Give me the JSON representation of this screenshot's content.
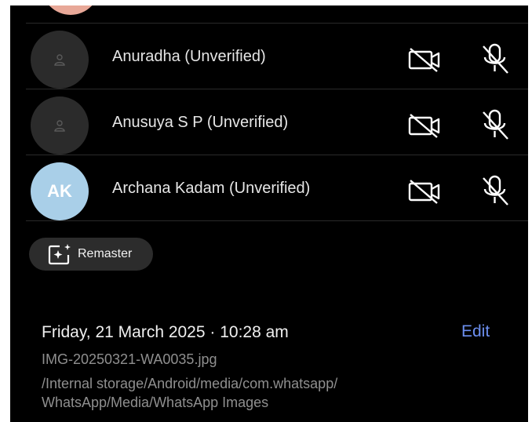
{
  "participants": [
    {
      "name": "Anuradha (Unverified)",
      "initials": "",
      "avatar_color": "#2b2b2b",
      "avatar_icon": "person-icon",
      "camera_icon": "camera-off-icon",
      "mic_icon": "mic-off-icon"
    },
    {
      "name": "Anusuya S P (Unverified)",
      "initials": "",
      "avatar_color": "#2b2b2b",
      "avatar_icon": "person-icon",
      "camera_icon": "camera-off-icon",
      "mic_icon": "mic-off-icon"
    },
    {
      "name": "Archana Kadam (Unverified)",
      "initials": "AK",
      "avatar_color": "#a9cfe8",
      "camera_icon": "camera-off-icon",
      "mic_icon": "mic-off-icon"
    }
  ],
  "remaster": {
    "label": "Remaster",
    "icon": "sparkle-image-icon"
  },
  "details": {
    "date": "Friday, 21 March 2025 · 10:28 am",
    "edit_label": "Edit",
    "filename": "IMG-20250321-WA0035.jpg",
    "path": "/Internal storage/Android/media/com.whatsapp/ WhatsApp/Media/WhatsApp Images"
  },
  "colors": {
    "background": "#000000",
    "accent": "#6c8ff0",
    "muted_text": "#8f8f8f"
  }
}
